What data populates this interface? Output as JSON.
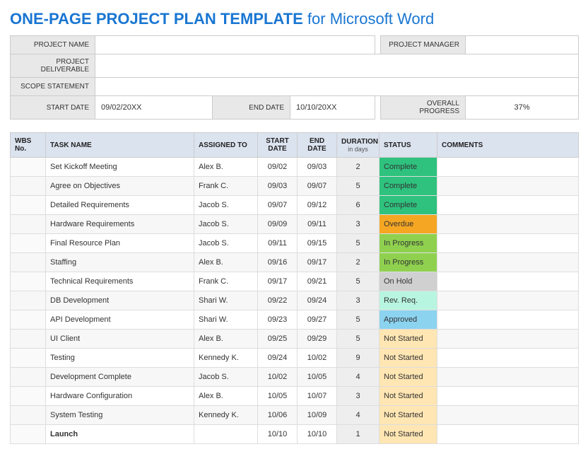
{
  "title_main": "ONE-PAGE PROJECT PLAN TEMPLATE",
  "title_for": " for ",
  "title_app": "Microsoft Word",
  "meta": {
    "project_name_lbl": "PROJECT NAME",
    "project_name_val": "",
    "project_manager_lbl": "PROJECT MANAGER",
    "project_manager_val": "",
    "deliverable_lbl": "PROJECT DELIVERABLE",
    "deliverable_val": "",
    "scope_lbl": "SCOPE STATEMENT",
    "scope_val": "",
    "start_date_lbl": "START DATE",
    "start_date_val": "09/02/20XX",
    "end_date_lbl": "END DATE",
    "end_date_val": "10/10/20XX",
    "progress_lbl": "OVERALL PROGRESS",
    "progress_val": "37%"
  },
  "cols": {
    "wbs": "WBS No.",
    "task": "TASK NAME",
    "assigned": "ASSIGNED TO",
    "start": "START DATE",
    "end": "END DATE",
    "duration": "DURATION",
    "duration_sub": "in days",
    "status": "STATUS",
    "comments": "COMMENTS"
  },
  "chart_data": {
    "type": "table",
    "columns": [
      "WBS No.",
      "TASK NAME",
      "ASSIGNED TO",
      "START DATE",
      "END DATE",
      "DURATION (days)",
      "STATUS",
      "COMMENTS"
    ],
    "rows": [
      [
        "",
        "Set Kickoff Meeting",
        "Alex B.",
        "09/02",
        "09/03",
        2,
        "Complete",
        ""
      ],
      [
        "",
        "Agree on Objectives",
        "Frank C.",
        "09/03",
        "09/07",
        5,
        "Complete",
        ""
      ],
      [
        "",
        "Detailed Requirements",
        "Jacob S.",
        "09/07",
        "09/12",
        6,
        "Complete",
        ""
      ],
      [
        "",
        "Hardware Requirements",
        "Jacob S.",
        "09/09",
        "09/11",
        3,
        "Overdue",
        ""
      ],
      [
        "",
        "Final Resource Plan",
        "Jacob S.",
        "09/11",
        "09/15",
        5,
        "In Progress",
        ""
      ],
      [
        "",
        "Staffing",
        "Alex B.",
        "09/16",
        "09/17",
        2,
        "In Progress",
        ""
      ],
      [
        "",
        "Technical Requirements",
        "Frank C.",
        "09/17",
        "09/21",
        5,
        "On Hold",
        ""
      ],
      [
        "",
        "DB Development",
        "Shari W.",
        "09/22",
        "09/24",
        3,
        "Rev. Req.",
        ""
      ],
      [
        "",
        "API Development",
        "Shari W.",
        "09/23",
        "09/27",
        5,
        "Approved",
        ""
      ],
      [
        "",
        "UI Client",
        "Alex B.",
        "09/25",
        "09/29",
        5,
        "Not Started",
        ""
      ],
      [
        "",
        "Testing",
        "Kennedy K.",
        "09/24",
        "10/02",
        9,
        "Not Started",
        ""
      ],
      [
        "",
        "Development Complete",
        "Jacob S.",
        "10/02",
        "10/05",
        4,
        "Not Started",
        ""
      ],
      [
        "",
        "Hardware Configuration",
        "Alex B.",
        "10/05",
        "10/07",
        3,
        "Not Started",
        ""
      ],
      [
        "",
        "System Testing",
        "Kennedy K.",
        "10/06",
        "10/09",
        4,
        "Not Started",
        ""
      ],
      [
        "",
        "Launch",
        "",
        "10/10",
        "10/10",
        1,
        "Not Started",
        ""
      ]
    ]
  },
  "status_class": {
    "Complete": "st-complete",
    "Overdue": "st-overdue",
    "In Progress": "st-inprogress",
    "On Hold": "st-onhold",
    "Rev. Req.": "st-revreq",
    "Approved": "st-approved",
    "Not Started": "st-notstarted"
  }
}
